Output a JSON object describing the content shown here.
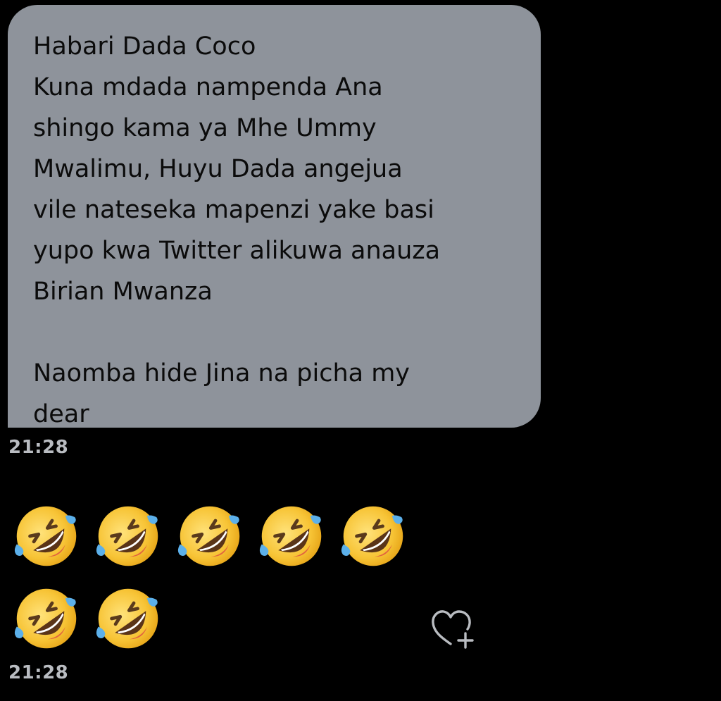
{
  "message": {
    "lines": [
      "Habari Dada Coco",
      "Kuna mdada nampenda Ana",
      "shingo kama ya Mhe Ummy",
      "Mwalimu, Huyu Dada angejua",
      "vile nateseka mapenzi yake basi",
      "yupo kwa Twitter alikuwa anauza",
      "Birian Mwanza",
      "",
      "Naomba hide Jina na picha my",
      "dear"
    ],
    "time": "21:28",
    "bubble_color": "#8e939b",
    "text_color": "#0b0b0b"
  },
  "emoji_message": {
    "emoji_name": "rolling-on-the-floor-laughing",
    "count": 7,
    "time": "21:28"
  },
  "react_button": {
    "icon": "heart-plus-icon"
  },
  "theme": {
    "background": "#000000",
    "timestamp_color": "#b9bcc1"
  }
}
